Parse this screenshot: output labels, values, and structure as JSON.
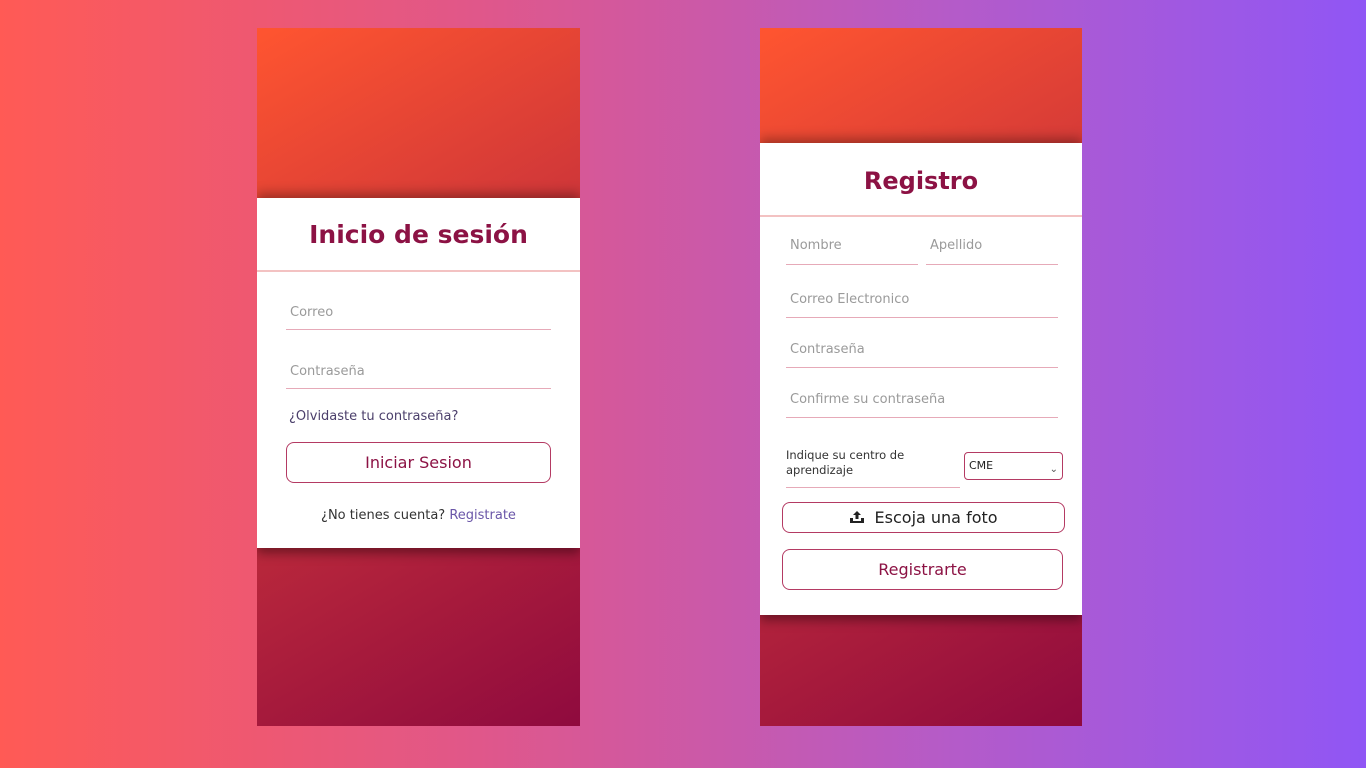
{
  "login": {
    "title": "Inicio de sesión",
    "email_placeholder": "Correo",
    "password_placeholder": "Contraseña",
    "forgot_link": "¿Olvidaste tu contraseña?",
    "submit_label": "Iniciar Sesion",
    "no_account_text": "¿No tienes cuenta?",
    "register_link": "Registrate"
  },
  "register": {
    "title": "Registro",
    "first_name_placeholder": "Nombre",
    "last_name_placeholder": "Apellido",
    "email_placeholder": "Correo Electronico",
    "password_placeholder": "Contraseña",
    "confirm_placeholder": "Confirme su contraseña",
    "center_label": "Indique su centro de aprendizaje",
    "center_selected": "CME",
    "photo_button_label": "Escoja una foto",
    "submit_label": "Registrarte"
  },
  "colors": {
    "accent": "#8c1244",
    "border": "#b43a63",
    "divider": "#f3c2c2"
  }
}
